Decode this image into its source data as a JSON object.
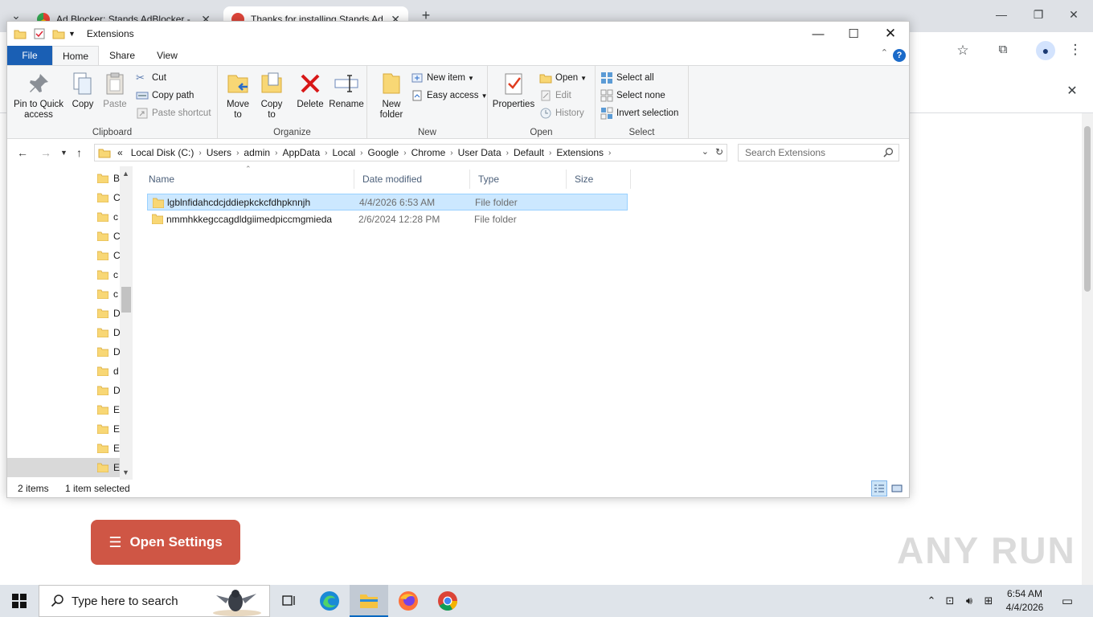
{
  "chrome": {
    "tabs": [
      {
        "title": "Ad Blocker: Stands AdBlocker -"
      },
      {
        "title": "Thanks for installing Stands Ad"
      }
    ],
    "page_button": "Open Settings",
    "watermark": "ANY RUN"
  },
  "explorer": {
    "title": "Extensions",
    "ribbon_tabs": [
      "File",
      "Home",
      "Share",
      "View"
    ],
    "groups": {
      "clipboard": {
        "label": "Clipboard",
        "pin": "Pin to Quick access",
        "copy": "Copy",
        "paste": "Paste",
        "cut": "Cut",
        "copy_path": "Copy path",
        "paste_shortcut": "Paste shortcut"
      },
      "organize": {
        "label": "Organize",
        "move_to": "Move to",
        "copy_to": "Copy to",
        "delete": "Delete",
        "rename": "Rename"
      },
      "new": {
        "label": "New",
        "new_folder": "New folder",
        "new_item": "New item",
        "easy_access": "Easy access"
      },
      "open": {
        "label": "Open",
        "properties": "Properties",
        "open": "Open",
        "edit": "Edit",
        "history": "History"
      },
      "select": {
        "label": "Select",
        "select_all": "Select all",
        "select_none": "Select none",
        "invert": "Invert selection"
      }
    },
    "address": {
      "prefix": "«",
      "crumbs": [
        "Local Disk (C:)",
        "Users",
        "admin",
        "AppData",
        "Local",
        "Google",
        "Chrome",
        "User Data",
        "Default",
        "Extensions"
      ]
    },
    "search_placeholder": "Search Extensions",
    "nav_items": [
      "B",
      "C",
      "c",
      "C",
      "C",
      "c",
      "c",
      "D",
      "D",
      "D",
      "d",
      "D",
      "E",
      "E",
      "E",
      "E"
    ],
    "columns": [
      "Name",
      "Date modified",
      "Type",
      "Size"
    ],
    "files": [
      {
        "name": "lgblnfidahcdcjddiepkckcfdhpknnjh",
        "date": "4/4/2026 6:53 AM",
        "type": "File folder",
        "size": "",
        "selected": true
      },
      {
        "name": "nmmhkkegccagdldgiimedpiccmgmieda",
        "date": "2/6/2024 12:28 PM",
        "type": "File folder",
        "size": "",
        "selected": false
      }
    ],
    "status": {
      "items": "2 items",
      "selected": "1 item selected"
    }
  },
  "taskbar": {
    "search_placeholder": "Type here to search",
    "time": "6:54 AM",
    "date": "4/4/2026"
  },
  "colors": {
    "file_tab": "#1a5fb4",
    "selection": "#cce8ff",
    "settings_button": "#cf5645"
  }
}
